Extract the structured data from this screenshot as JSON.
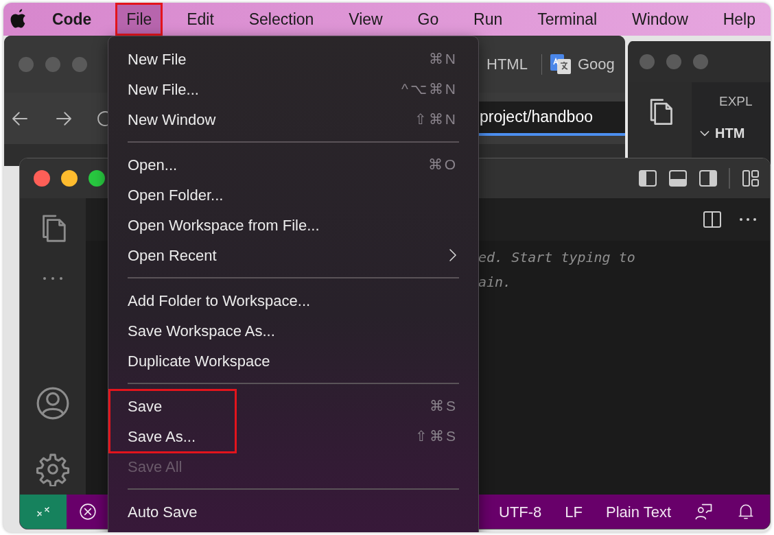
{
  "menu_bar": {
    "items": [
      {
        "kind": "app",
        "label": "Code",
        "selected": false,
        "boxed": false
      },
      {
        "kind": "menu",
        "label": "File",
        "selected": true,
        "boxed": true
      },
      {
        "kind": "menu",
        "label": "Edit",
        "selected": false,
        "boxed": false
      },
      {
        "kind": "menu",
        "label": "Selection",
        "selected": false,
        "boxed": false
      },
      {
        "kind": "menu",
        "label": "View",
        "selected": false,
        "boxed": false
      },
      {
        "kind": "menu",
        "label": "Go",
        "selected": false,
        "boxed": false
      },
      {
        "kind": "menu",
        "label": "Run",
        "selected": false,
        "boxed": false
      },
      {
        "kind": "menu",
        "label": "Terminal",
        "selected": false,
        "boxed": false
      },
      {
        "kind": "menu",
        "label": "Window",
        "selected": false,
        "boxed": false
      },
      {
        "kind": "menu",
        "label": "Help",
        "selected": false,
        "boxed": false
      }
    ]
  },
  "browser_window": {
    "tabs": [
      "HTML",
      "Goog"
    ],
    "address": "project/handboo"
  },
  "explorer_window": {
    "title": "EXPL",
    "folder": "HTM",
    "expanded": true
  },
  "editor_window": {
    "hint_lines": [
      "ed. Start typing to",
      "ain."
    ],
    "status_bar": {
      "items": [
        "UTF-8",
        "LF",
        "Plain Text"
      ]
    }
  },
  "file_menu": {
    "items": [
      {
        "kind": "item",
        "label": "New File",
        "shortcut": "⌘N",
        "disabled": false,
        "submenu": false,
        "boxed": false
      },
      {
        "kind": "item",
        "label": "New File...",
        "shortcut": "^⌥⌘N",
        "disabled": false,
        "submenu": false,
        "boxed": false
      },
      {
        "kind": "item",
        "label": "New Window",
        "shortcut": "⇧⌘N",
        "disabled": false,
        "submenu": false,
        "boxed": false
      },
      {
        "kind": "separator"
      },
      {
        "kind": "item",
        "label": "Open...",
        "shortcut": "⌘O",
        "disabled": false,
        "submenu": false,
        "boxed": false
      },
      {
        "kind": "item",
        "label": "Open Folder...",
        "disabled": false,
        "submenu": false,
        "boxed": false
      },
      {
        "kind": "item",
        "label": "Open Workspace from File...",
        "disabled": false,
        "submenu": false,
        "boxed": false
      },
      {
        "kind": "item",
        "label": "Open Recent",
        "disabled": false,
        "submenu": true,
        "boxed": false
      },
      {
        "kind": "separator"
      },
      {
        "kind": "item",
        "label": "Add Folder to Workspace...",
        "disabled": false,
        "submenu": false,
        "boxed": false
      },
      {
        "kind": "item",
        "label": "Save Workspace As...",
        "disabled": false,
        "submenu": false,
        "boxed": false
      },
      {
        "kind": "item",
        "label": "Duplicate Workspace",
        "disabled": false,
        "submenu": false,
        "boxed": false
      },
      {
        "kind": "separator"
      },
      {
        "kind": "item",
        "label": "Save",
        "shortcut": "⌘S",
        "disabled": false,
        "submenu": false,
        "boxed": true
      },
      {
        "kind": "item",
        "label": "Save As...",
        "shortcut": "⇧⌘S",
        "disabled": false,
        "submenu": false,
        "boxed": true
      },
      {
        "kind": "item",
        "label": "Save All",
        "disabled": true,
        "submenu": false,
        "boxed": false
      },
      {
        "kind": "separator"
      },
      {
        "kind": "item",
        "label": "Auto Save",
        "disabled": false,
        "submenu": false,
        "boxed": false
      }
    ]
  }
}
